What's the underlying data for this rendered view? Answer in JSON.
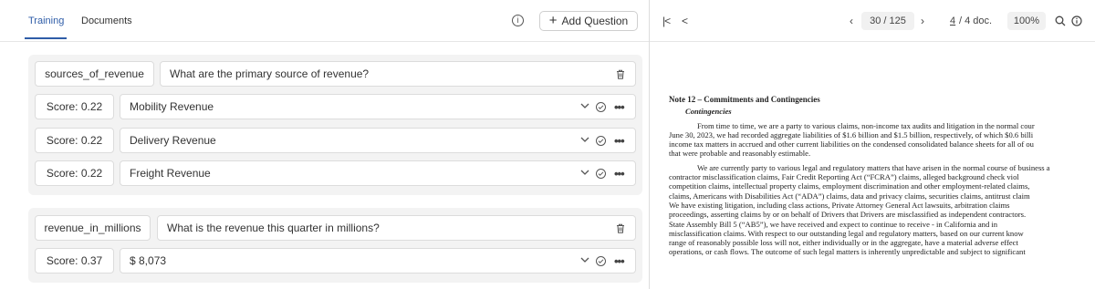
{
  "tabs": [
    {
      "label": "Training",
      "active": true
    },
    {
      "label": "Documents",
      "active": false
    }
  ],
  "toolbar": {
    "info_glyph": "i",
    "add_question_label": "Add Question"
  },
  "questions": [
    {
      "key": "sources_of_revenue",
      "question": "What are the primary source of revenue?",
      "answers": [
        {
          "score": "Score: 0.22",
          "value": "Mobility Revenue"
        },
        {
          "score": "Score: 0.22",
          "value": "Delivery Revenue"
        },
        {
          "score": "Score: 0.22",
          "value": "Freight Revenue"
        }
      ]
    },
    {
      "key": "revenue_in_millions",
      "question": "What is the revenue this quarter in millions?",
      "answers": [
        {
          "score": "Score: 0.37",
          "value": "$ 8,073"
        }
      ]
    }
  ],
  "viewer": {
    "first_page_glyph": "|<",
    "prev_glyph": "<",
    "page_prev_glyph": "‹",
    "page_indicator": "30 / 125",
    "page_next_glyph": "›",
    "doc_current": "4",
    "doc_total": "/ 4 doc.",
    "zoom": "100%",
    "search_icon": "search-icon",
    "info_icon": "info-icon"
  },
  "document": {
    "heading": "Note 12 – Commitments and Contingencies",
    "subheading": "Contingencies",
    "para1": [
      "From time to time, we are a party to various claims, non-income tax audits and litigation in the normal cour",
      "June 30, 2023, we had recorded aggregate liabilities of $1.6 billion and $1.5 billion, respectively, of which $0.6 billi",
      "income tax matters in accrued and other current liabilities on the condensed consolidated balance sheets for all of ou",
      "that were probable and reasonably estimable."
    ],
    "para2": [
      "We are currently party to various legal and regulatory matters that have arisen in the normal course of business a",
      "contractor misclassification claims, Fair Credit Reporting Act (“FCRA”) claims, alleged background check viol",
      "competition claims, intellectual property claims, employment discrimination and other employment-related claims,",
      "claims, Americans with Disabilities Act (“ADA”) claims, data and privacy claims, securities claims, antitrust claim",
      "We have existing litigation, including class actions, Private Attorney General Act lawsuits, arbitration claims",
      "proceedings, asserting claims by or on behalf of Drivers that Drivers are misclassified as independent contractors.",
      "State Assembly Bill 5 (“AB5”), we have received and expect to continue to receive - in California and in",
      "misclassification claims. With respect to our outstanding legal and regulatory matters, based on our current know",
      "range of reasonably possible loss will not, either individually or in the aggregate, have a material adverse effect",
      "operations, or cash flows. The outcome of such legal matters is inherently unpredictable and subject to significant"
    ]
  },
  "colors": {
    "accent": "#2f5da8",
    "group_bg": "#f3f3f3",
    "border": "#dcdcdc"
  }
}
